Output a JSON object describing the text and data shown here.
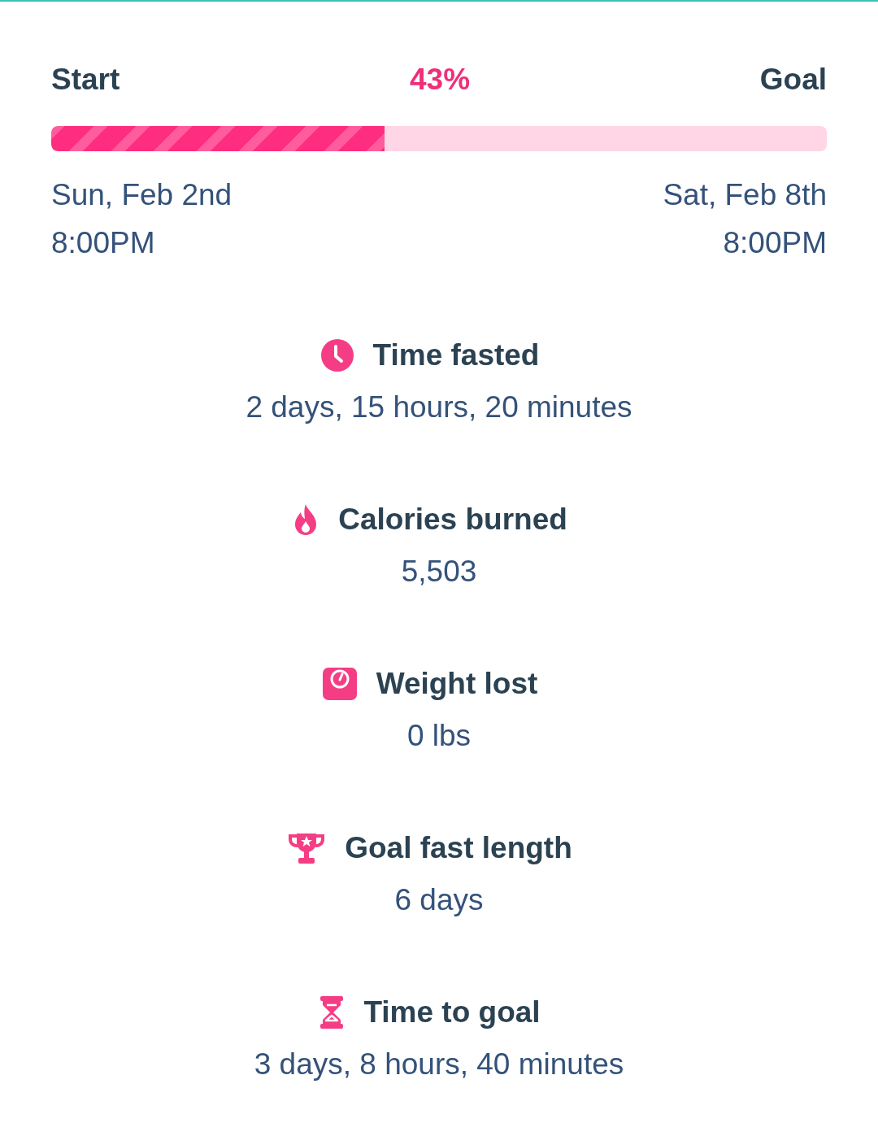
{
  "progress": {
    "start_label": "Start",
    "percent": "43%",
    "goal_label": "Goal",
    "level": 0.43,
    "start_date": "Sun, Feb 2nd",
    "start_time": "8:00PM",
    "goal_date": "Sat, Feb 8th",
    "goal_time": "8:00PM"
  },
  "stats": [
    {
      "kind": "clock",
      "title": "Time fasted",
      "value": "2 days, 15 hours, 20 minutes"
    },
    {
      "kind": "flame",
      "title": "Calories burned",
      "value": "5,503"
    },
    {
      "kind": "scale",
      "title": "Weight lost",
      "value": "0 lbs"
    },
    {
      "kind": "trophy",
      "title": "Goal fast length",
      "value": "6 days"
    },
    {
      "kind": "hourglass",
      "title": "Time to goal",
      "value": "3 days, 8 hours, 40 minutes"
    }
  ]
}
